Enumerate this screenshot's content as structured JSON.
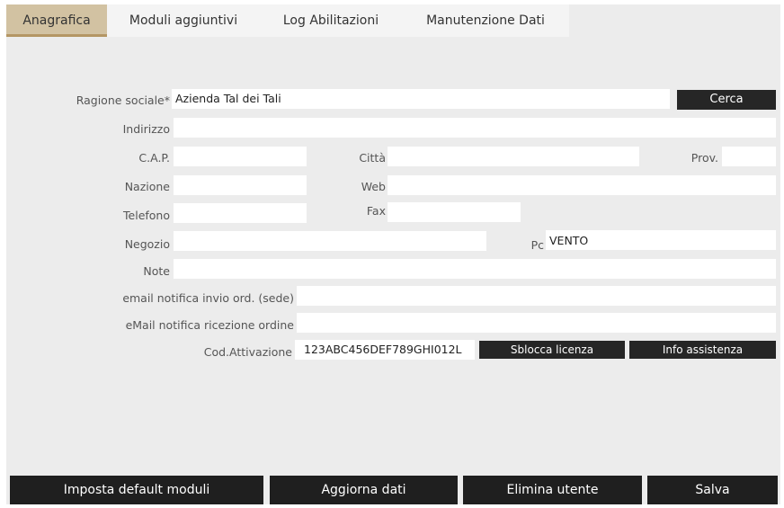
{
  "tabs": [
    {
      "label": "Anagrafica",
      "active": true
    },
    {
      "label": "Moduli aggiuntivi",
      "active": false
    },
    {
      "label": "Log Abilitazioni",
      "active": false
    },
    {
      "label": "Manutenzione Dati",
      "active": false
    }
  ],
  "form": {
    "ragione_sociale": {
      "label": "Ragione sociale*",
      "value": "Azienda Tal dei Tali"
    },
    "cerca_button": "Cerca",
    "indirizzo": {
      "label": "Indirizzo",
      "value": ""
    },
    "cap": {
      "label": "C.A.P.",
      "value": ""
    },
    "citta": {
      "label": "Città",
      "value": ""
    },
    "prov": {
      "label": "Prov.",
      "value": ""
    },
    "nazione": {
      "label": "Nazione",
      "value": ""
    },
    "web": {
      "label": "Web",
      "value": ""
    },
    "telefono": {
      "label": "Telefono",
      "value": ""
    },
    "fax": {
      "label": "Fax",
      "value": ""
    },
    "negozio": {
      "label": "Negozio",
      "value": ""
    },
    "pc": {
      "label": "Pc",
      "value": "VENTO"
    },
    "note": {
      "label": "Note",
      "value": ""
    },
    "email_invio": {
      "label": "email notifica invio ord. (sede)",
      "value": ""
    },
    "email_ricezione": {
      "label": "eMail notifica ricezione ordine",
      "value": ""
    },
    "cod_attivazione": {
      "label": "Cod.Attivazione",
      "value": "123ABC456DEF789GHI012L"
    },
    "sblocca_button": "Sblocca licenza",
    "info_button": "Info assistenza"
  },
  "footer": {
    "imposta": "Imposta default moduli",
    "aggiorna": "Aggiorna dati",
    "elimina": "Elimina utente",
    "salva": "Salva"
  },
  "colors": {
    "active_tab": "#d2c2a2",
    "button": "#262626",
    "panel": "#ececec"
  }
}
